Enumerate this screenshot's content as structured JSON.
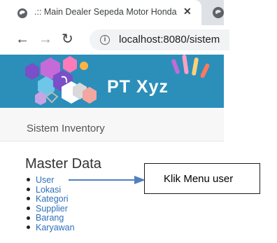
{
  "browser": {
    "tab_title": ".:: Main Dealer Sepeda Motor Honda",
    "tab_close": "✕",
    "url": "localhost:8080/sistem"
  },
  "banner": {
    "title": "PT Xyz"
  },
  "navbar": {
    "brand": "Sistem Inventory"
  },
  "main": {
    "heading": "Master Data",
    "menu": [
      "User",
      "Lokasi",
      "Kategori",
      "Supplier",
      "Barang",
      "Karyawan"
    ]
  },
  "annotation": {
    "callout_text": "Klik Menu user"
  },
  "colors": {
    "banner_bg": "#2b8fba",
    "link": "#2f6fba",
    "callout_arrow": "#4f81bd"
  }
}
